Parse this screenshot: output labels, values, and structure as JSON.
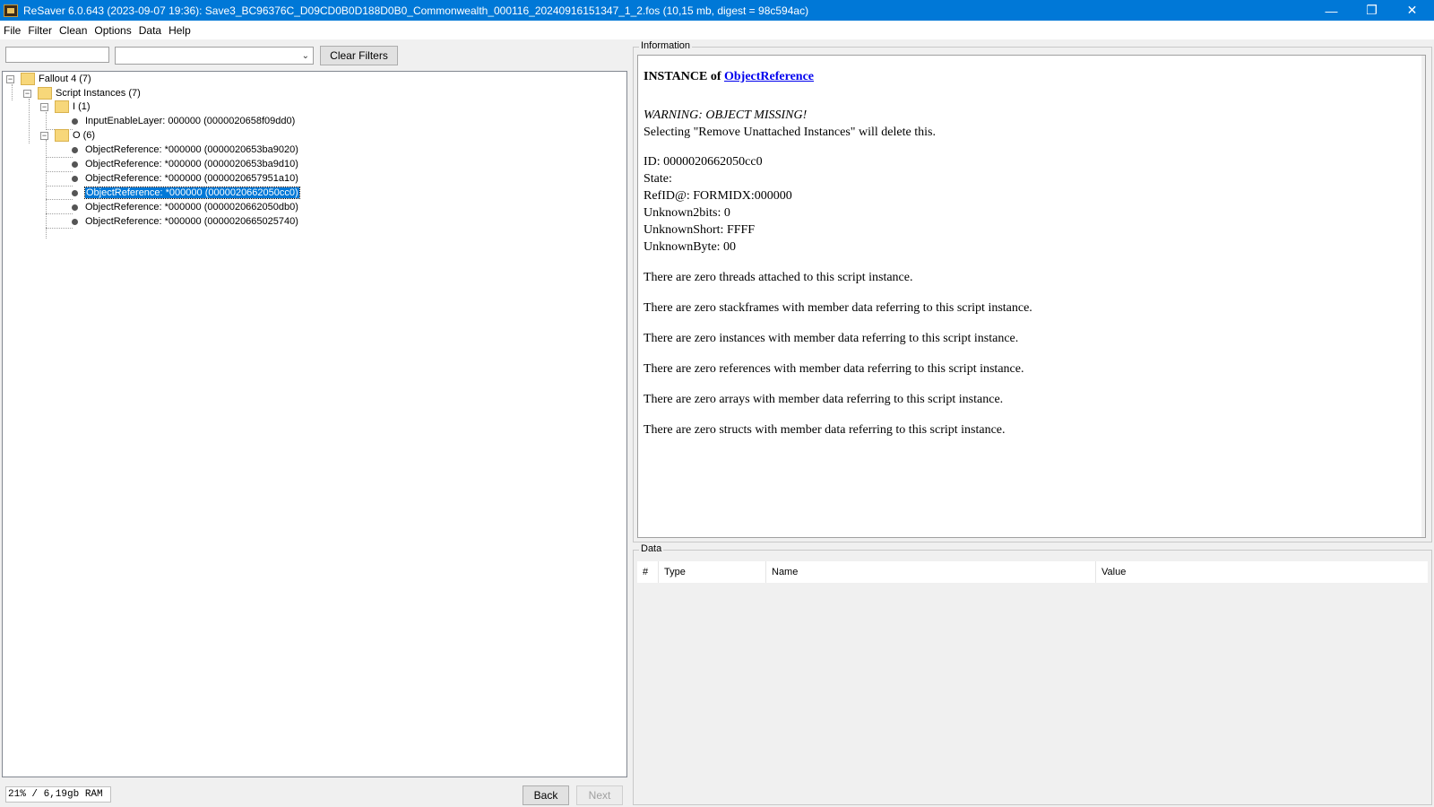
{
  "window": {
    "title": "ReSaver 6.0.643 (2023-09-07 19:36): Save3_BC96376C_D09CD0B0D188D0B0_Commonwealth_000116_20240916151347_1_2.fos (10,15 mb, digest = 98c594ac)",
    "controls": {
      "minimize": "—",
      "restore": "❐",
      "close": "✕"
    }
  },
  "menu": [
    "File",
    "Filter",
    "Clean",
    "Options",
    "Data",
    "Help"
  ],
  "filter": {
    "text_value": "",
    "combo_value": "",
    "clear_label": "Clear Filters"
  },
  "tree": {
    "root": "Fallout 4 (7)",
    "group": "Script Instances (7)",
    "folders": [
      {
        "label": "I (1)",
        "items": [
          "InputEnableLayer: 000000 (0000020658f09dd0)"
        ]
      },
      {
        "label": "O (6)",
        "items": [
          "ObjectReference: *000000 (0000020653ba9020)",
          "ObjectReference: *000000 (0000020653ba9d10)",
          "ObjectReference: *000000 (0000020657951a10)",
          "ObjectReference: *000000 (0000020662050cc0)",
          "ObjectReference: *000000 (0000020662050db0)",
          "ObjectReference: *000000 (0000020665025740)"
        ]
      }
    ],
    "selected": "ObjectReference: *000000 (0000020662050cc0)"
  },
  "status": {
    "ram": "21% / 6,19gb RAM",
    "back_label": "Back",
    "next_label": "Next"
  },
  "info": {
    "legend": "Information",
    "heading_prefix": "INSTANCE of ",
    "heading_link": "ObjectReference",
    "warning": "WARNING: OBJECT MISSING!",
    "warning_note": "Selecting \"Remove Unattached Instances\" will delete this.",
    "fields": [
      "ID: 0000020662050cc0",
      "State:",
      "RefID@: FORMIDX:000000",
      "Unknown2bits: 0",
      "UnknownShort: FFFF",
      "UnknownByte: 00"
    ],
    "paragraphs": [
      "There are zero threads attached to this script instance.",
      "There are zero stackframes with member data referring to this script instance.",
      "There are zero instances with member data referring to this script instance.",
      "There are zero references with member data referring to this script instance.",
      "There are zero arrays with member data referring to this script instance.",
      "There are zero structs with member data referring to this script instance."
    ]
  },
  "data": {
    "legend": "Data",
    "columns": [
      "#",
      "Type",
      "Name",
      "Value"
    ]
  }
}
